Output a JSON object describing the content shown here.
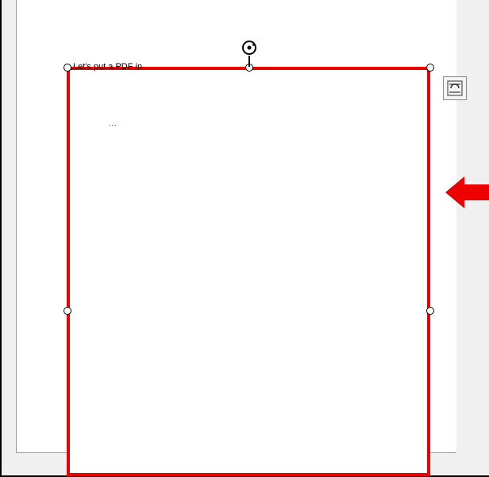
{
  "document": {
    "caption": "Let's put a PDF in",
    "ellipsis": "..."
  },
  "selection": {
    "border_color": "#ee0000",
    "handles_visible": true
  },
  "ui": {
    "layout_options_visible": true
  },
  "annotation": {
    "arrow_color": "#ee0000"
  }
}
